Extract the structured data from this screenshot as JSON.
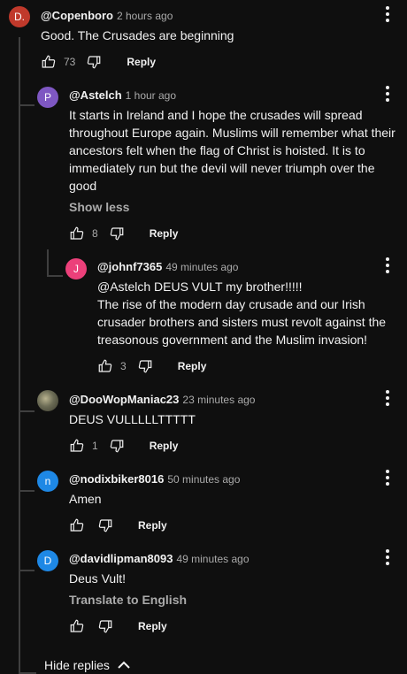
{
  "comments": [
    {
      "author": "@Copenboro",
      "time": "2 hours ago",
      "avatar_letter": "D.",
      "avatar_color": "#c0392b",
      "lines": [
        "Good. The Crusades are beginning"
      ],
      "likes": "73",
      "reply_label": "Reply"
    },
    {
      "author": "@Astelch",
      "time": "1 hour ago",
      "avatar_letter": "P",
      "avatar_color": "#7e57c2",
      "lines": [
        "It starts in Ireland and I hope the crusades will spread",
        "throughout Europe again. Muslims will remember what their",
        "ancestors felt when the flag of Christ is hoisted. It is to",
        "immediately run but the devil will never triumph over the",
        "good"
      ],
      "show_less": "Show less",
      "likes": "8",
      "reply_label": "Reply"
    },
    {
      "author": "@johnf7365",
      "time": "49 minutes ago",
      "avatar_letter": "J",
      "avatar_color": "#ec407a",
      "lines": [
        "@Astelch DEUS VULT my brother!!!!!",
        "The rise of the modern day crusade and our Irish",
        "crusader brothers and sisters must revolt against the",
        "treasonous government and the Muslim invasion!"
      ],
      "likes": "3",
      "reply_label": "Reply"
    },
    {
      "author": "@DooWopManiac23",
      "time": "23 minutes ago",
      "avatar_letter": "",
      "avatar_color": "#6b6b55",
      "lines": [
        "DEUS VULLLLLTTTTT"
      ],
      "likes": "1",
      "reply_label": "Reply"
    },
    {
      "author": "@nodixbiker8016",
      "time": "50 minutes ago",
      "avatar_letter": "n",
      "avatar_color": "#1e88e5",
      "lines": [
        "Amen"
      ],
      "likes": "",
      "reply_label": "Reply"
    },
    {
      "author": "@davidlipman8093",
      "time": "49 minutes ago",
      "avatar_letter": "D",
      "avatar_color": "#1e88e5",
      "lines": [
        "Deus Vult!"
      ],
      "translate": "Translate to English",
      "likes": "",
      "reply_label": "Reply"
    }
  ],
  "hide_replies": "Hide replies",
  "colors": {
    "background": "#0f0f0f",
    "text": "#f1f1f1",
    "muted": "#aaaaaa",
    "thread": "#3f3f3f"
  }
}
